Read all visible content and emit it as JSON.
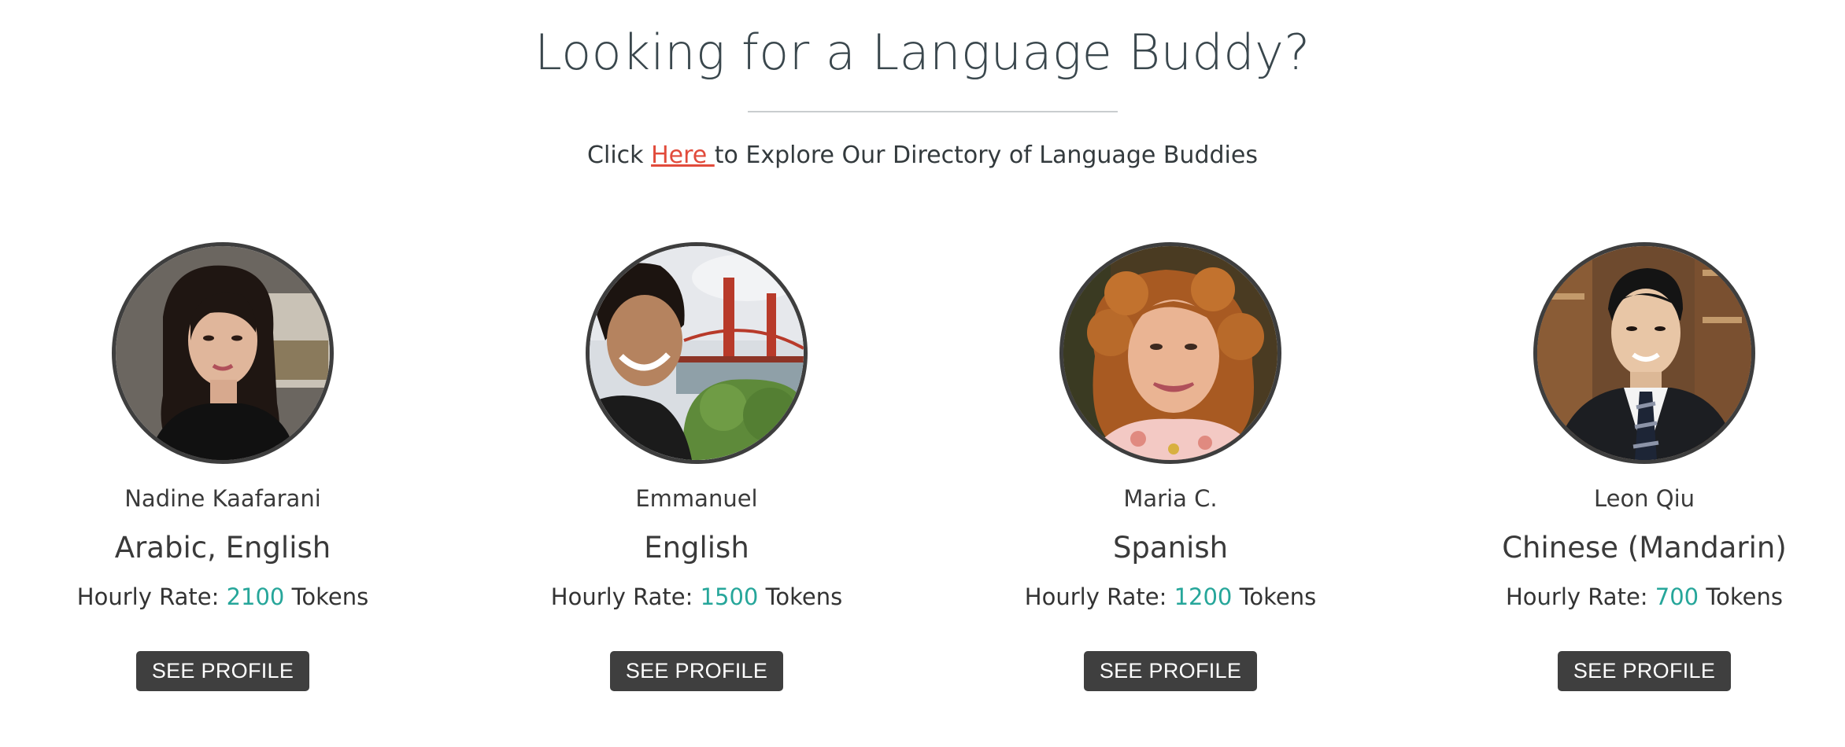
{
  "header": {
    "title": "Looking for a Language Buddy?",
    "subtitle_prefix": "Click ",
    "subtitle_link": "Here ",
    "subtitle_suffix": "to Explore Our Directory of Language Buddies"
  },
  "buddies": [
    {
      "name": "Nadine Kaafarani",
      "languages": "Arabic, English",
      "rate_label": "Hourly Rate: ",
      "rate_value": "2100",
      "rate_unit": " Tokens",
      "button_label": "SEE PROFILE"
    },
    {
      "name": "Emmanuel",
      "languages": "English",
      "rate_label": "Hourly Rate: ",
      "rate_value": "1500",
      "rate_unit": " Tokens",
      "button_label": "SEE PROFILE"
    },
    {
      "name": "Maria C.",
      "languages": "Spanish",
      "rate_label": "Hourly Rate: ",
      "rate_value": "1200",
      "rate_unit": " Tokens",
      "button_label": "SEE PROFILE"
    },
    {
      "name": "Leon Qiu",
      "languages": "Chinese (Mandarin)",
      "rate_label": "Hourly Rate: ",
      "rate_value": "700",
      "rate_unit": " Tokens",
      "button_label": "SEE PROFILE"
    }
  ],
  "colors": {
    "accent_value": "#26a69a",
    "link": "#e14b3b",
    "button_bg": "#3f3f3f"
  }
}
